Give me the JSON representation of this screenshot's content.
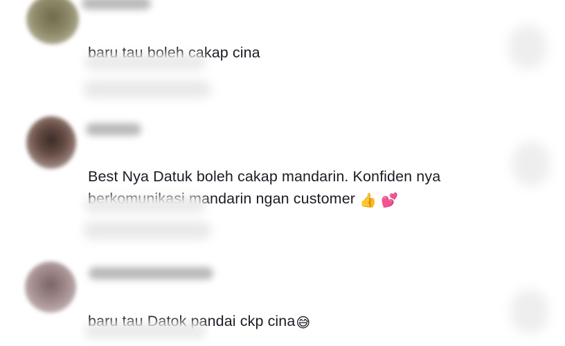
{
  "comments": [
    {
      "text": "baru tau boleh cakap cina"
    },
    {
      "text": "Best Nya Datuk boleh cakap mandarin. Konfiden nya berkomunikasi mandarin ngan customer",
      "emoji_1": "👍",
      "emoji_2": "💕"
    },
    {
      "text": "baru tau Datok pandai ckp cina",
      "emoji_1": "😅"
    }
  ],
  "icons": [
    "thumbs-up-emoji",
    "two-hearts-emoji",
    "sweat-smile-emoji"
  ]
}
